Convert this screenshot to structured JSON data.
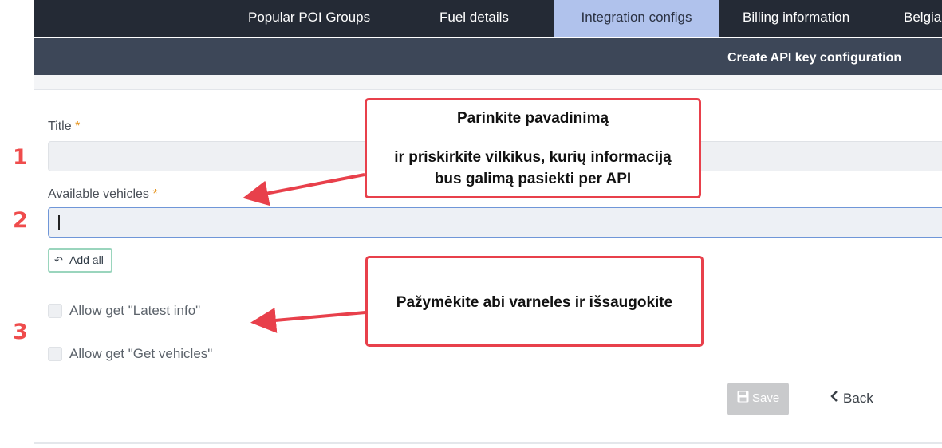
{
  "nav": {
    "tabs": [
      {
        "label": "Popular POI Groups",
        "active": false
      },
      {
        "label": "Fuel details",
        "active": false
      },
      {
        "label": "Integration configs",
        "active": true
      },
      {
        "label": "Billing information",
        "active": false
      },
      {
        "label": "Belgia",
        "active": false
      }
    ]
  },
  "subheader": {
    "title": "Create API key configuration"
  },
  "form": {
    "title_label": "Title",
    "vehicles_label": "Available vehicles",
    "required_mark": "*",
    "add_all_label": "Add all",
    "add_all_icon": "reply-all-icon",
    "checkboxes": [
      {
        "label": "Allow get \"Latest info\"",
        "checked": false
      },
      {
        "label": "Allow get \"Get vehicles\"",
        "checked": false
      }
    ],
    "save_label": "Save",
    "save_icon": "floppy-disk-icon",
    "back_label": "Back",
    "back_icon": "chevron-left-icon"
  },
  "annotations": {
    "steps": [
      "1",
      "2",
      "3"
    ],
    "callout1": {
      "line1": "Parinkite pavadinimą",
      "line2": "ir priskirkite vilkikus, kurių informaciją",
      "line3": "bus galimą pasiekti per API"
    },
    "callout2": {
      "text": "Pažymėkite abi varneles ir išsaugokite"
    },
    "color": "#e8404b"
  }
}
